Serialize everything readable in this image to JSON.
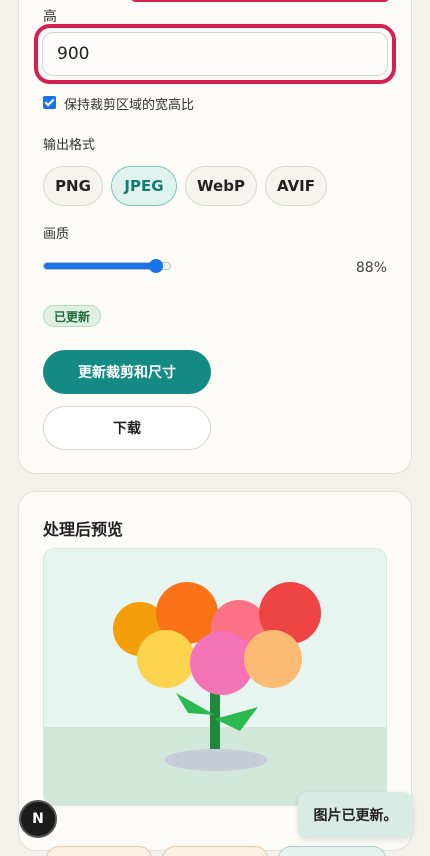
{
  "dimensions": {
    "field_label": "高",
    "height_value": "900",
    "keep_ratio_label": "保持裁剪区域的宽高比",
    "keep_ratio_checked": true
  },
  "format": {
    "label": "输出格式",
    "options": [
      "PNG",
      "JPEG",
      "WebP",
      "AVIF"
    ],
    "selected": "JPEG"
  },
  "quality": {
    "label": "画质",
    "value": 0.88,
    "value_text": "88%"
  },
  "status_badge": "已更新",
  "actions": {
    "update_label": "更新裁剪和尺寸",
    "download_label": "下载"
  },
  "preview": {
    "title": "处理后预览"
  },
  "fab": {
    "label": "N"
  },
  "toast": {
    "message": "图片已更新。"
  },
  "colors": {
    "accent": "#138a84",
    "highlight": "#d4204f",
    "slider": "#1a73e8",
    "background": "#f3f1ec"
  },
  "icons": {
    "fab": "n-logo-icon",
    "checkbox": "checkmark-icon"
  }
}
